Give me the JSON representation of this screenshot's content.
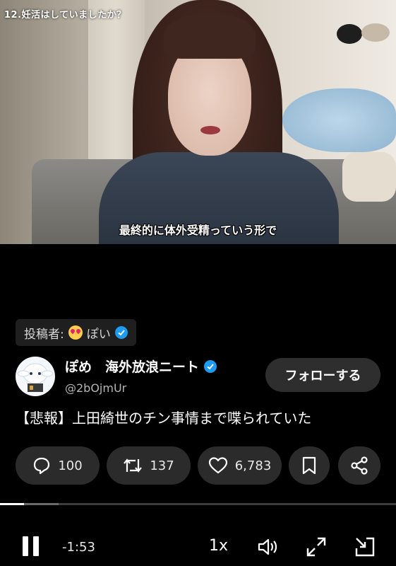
{
  "video": {
    "chapter": "12.妊活はしていましたか？",
    "subtitle": "最終的に体外受精っていう形で"
  },
  "poster": {
    "label": "投稿者:",
    "name": "ぽい"
  },
  "author": {
    "name": "ぽめ　海外放浪ニート",
    "handle": "@2bOjmUr",
    "follow_label": "フォローする"
  },
  "tweet": {
    "text": "【悲報】上田綺世のチン事情まで喋られていた"
  },
  "actions": {
    "replies": "100",
    "retweets": "137",
    "likes": "6,783"
  },
  "player": {
    "progress_fraction": 0.06,
    "time_remaining": "-1:53",
    "speed": "1x"
  },
  "colors": {
    "verified": "#1d9bf0",
    "action_bg": "#2b2b2b",
    "follow_bg": "#2e2e2e"
  },
  "icons": [
    "reply-icon",
    "retweet-icon",
    "heart-icon",
    "bookmark-icon",
    "share-icon",
    "pause-icon",
    "volume-icon",
    "fullscreen-icon",
    "exit-player-icon"
  ]
}
